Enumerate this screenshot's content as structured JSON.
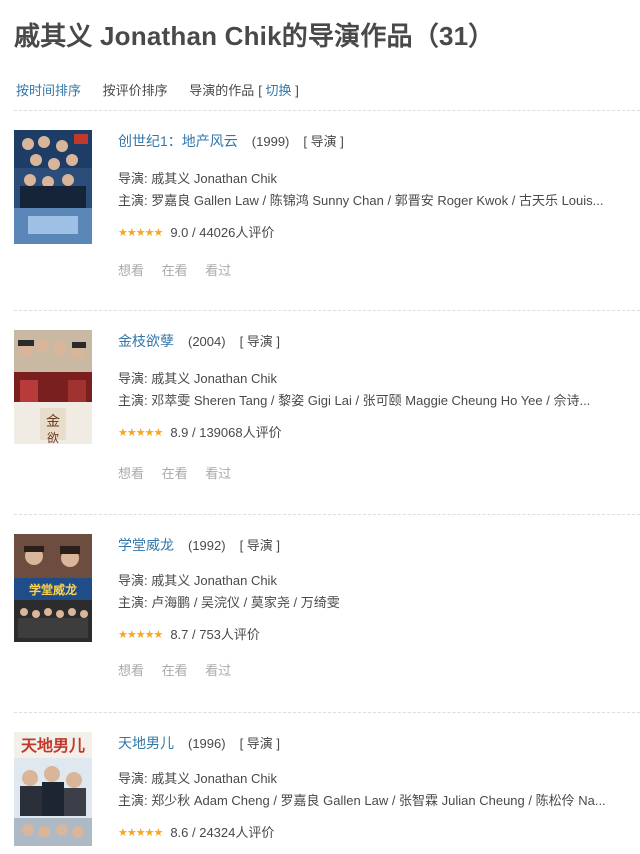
{
  "page": {
    "title": "戚其义 Jonathan Chik的导演作品（31）"
  },
  "sort": {
    "by_time": "按时间排序",
    "by_rating": "按评价排序",
    "works_label": "导演的作品",
    "switch_open": "[",
    "switch_label": "切换",
    "switch_close": "]"
  },
  "actions": {
    "want": "想看",
    "doing": "在看",
    "done": "看过"
  },
  "items": [
    {
      "title": "创世纪1：地产风云",
      "year": "(1999)",
      "role": "[ 导演 ]",
      "director": "导演: 戚其义 Jonathan Chik",
      "cast": "主演: 罗嘉良 Gallen Law / 陈锦鸿 Sunny Chan / 郭晋安 Roger Kwok / 古天乐 Louis...",
      "rating_text": "9.0 / 44026人评价",
      "stars": "★★★★★"
    },
    {
      "title": "金枝欲孽",
      "year": "(2004)",
      "role": "[ 导演 ]",
      "director": "导演: 戚其义 Jonathan Chik",
      "cast": "主演: 邓萃雯 Sheren Tang / 黎姿 Gigi Lai / 张可颐 Maggie Cheung Ho Yee / 佘诗...",
      "rating_text": "8.9 / 139068人评价",
      "stars": "★★★★★"
    },
    {
      "title": "学堂威龙",
      "year": "(1992)",
      "role": "[ 导演 ]",
      "director": "导演: 戚其义 Jonathan Chik",
      "cast": "主演: 卢海鹏 / 吴浣仪 / 莫家尧 / 万绮雯",
      "rating_text": "8.7 / 753人评价",
      "stars": "★★★★★"
    },
    {
      "title": "天地男儿",
      "year": "(1996)",
      "role": "[ 导演 ]",
      "director": "导演: 戚其义 Jonathan Chik",
      "cast": "主演: 郑少秋 Adam Cheng / 罗嘉良 Gallen Law / 张智霖 Julian Cheung / 陈松伶 Na...",
      "rating_text": "8.6 / 24324人评价",
      "stars": "★★★★★"
    }
  ]
}
